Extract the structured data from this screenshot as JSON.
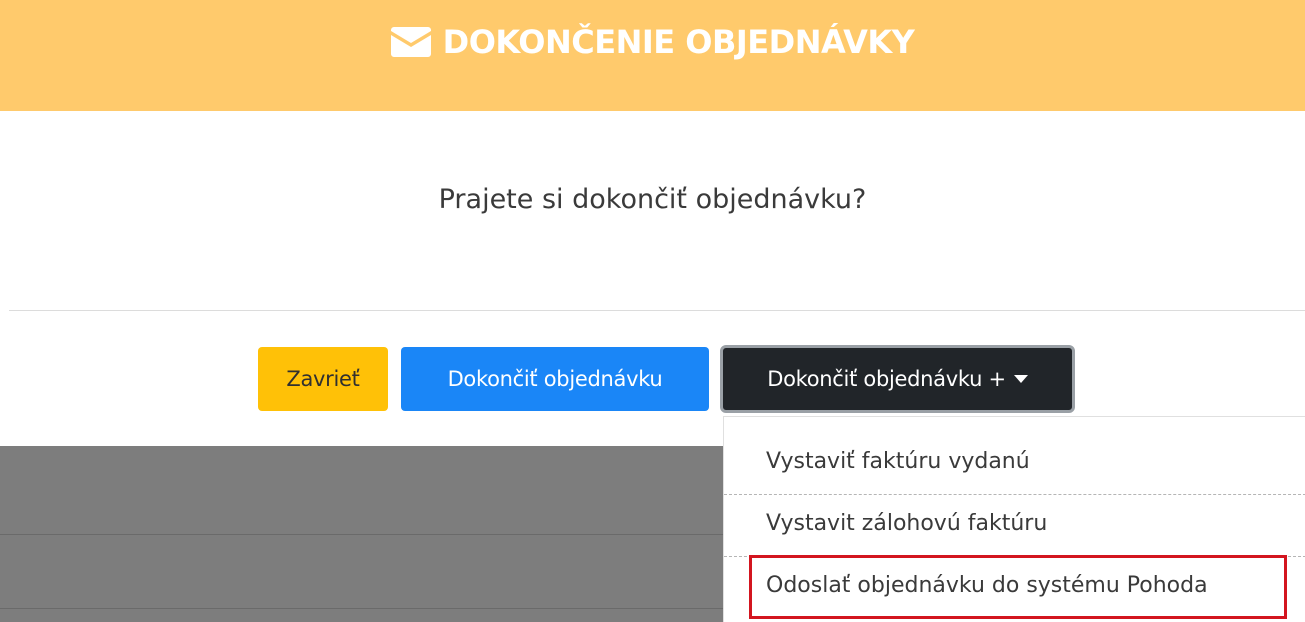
{
  "header": {
    "title": "DOKONČENIE OBJEDNÁVKY",
    "icon": "envelope-icon",
    "background_color": "#ffca6c"
  },
  "body": {
    "question": "Prajete si dokončiť objednávku?"
  },
  "buttons": {
    "close_label": "Zavrieť",
    "finish_label": "Dokončiť objednávku",
    "finish_plus_label": "Dokončiť objednávku +",
    "finish_plus_icon": "caret-down-icon",
    "colors": {
      "close": "#ffc107",
      "finish": "#1a86f7",
      "finish_plus": "#212529"
    }
  },
  "dropdown": {
    "items": [
      {
        "label": "Vystaviť faktúru vydanú"
      },
      {
        "label": "Vystavit zálohovú faktúru"
      },
      {
        "label": "Odoslať objednávku do systému Pohoda",
        "highlighted": true
      }
    ],
    "highlight_color": "#d3151f"
  }
}
